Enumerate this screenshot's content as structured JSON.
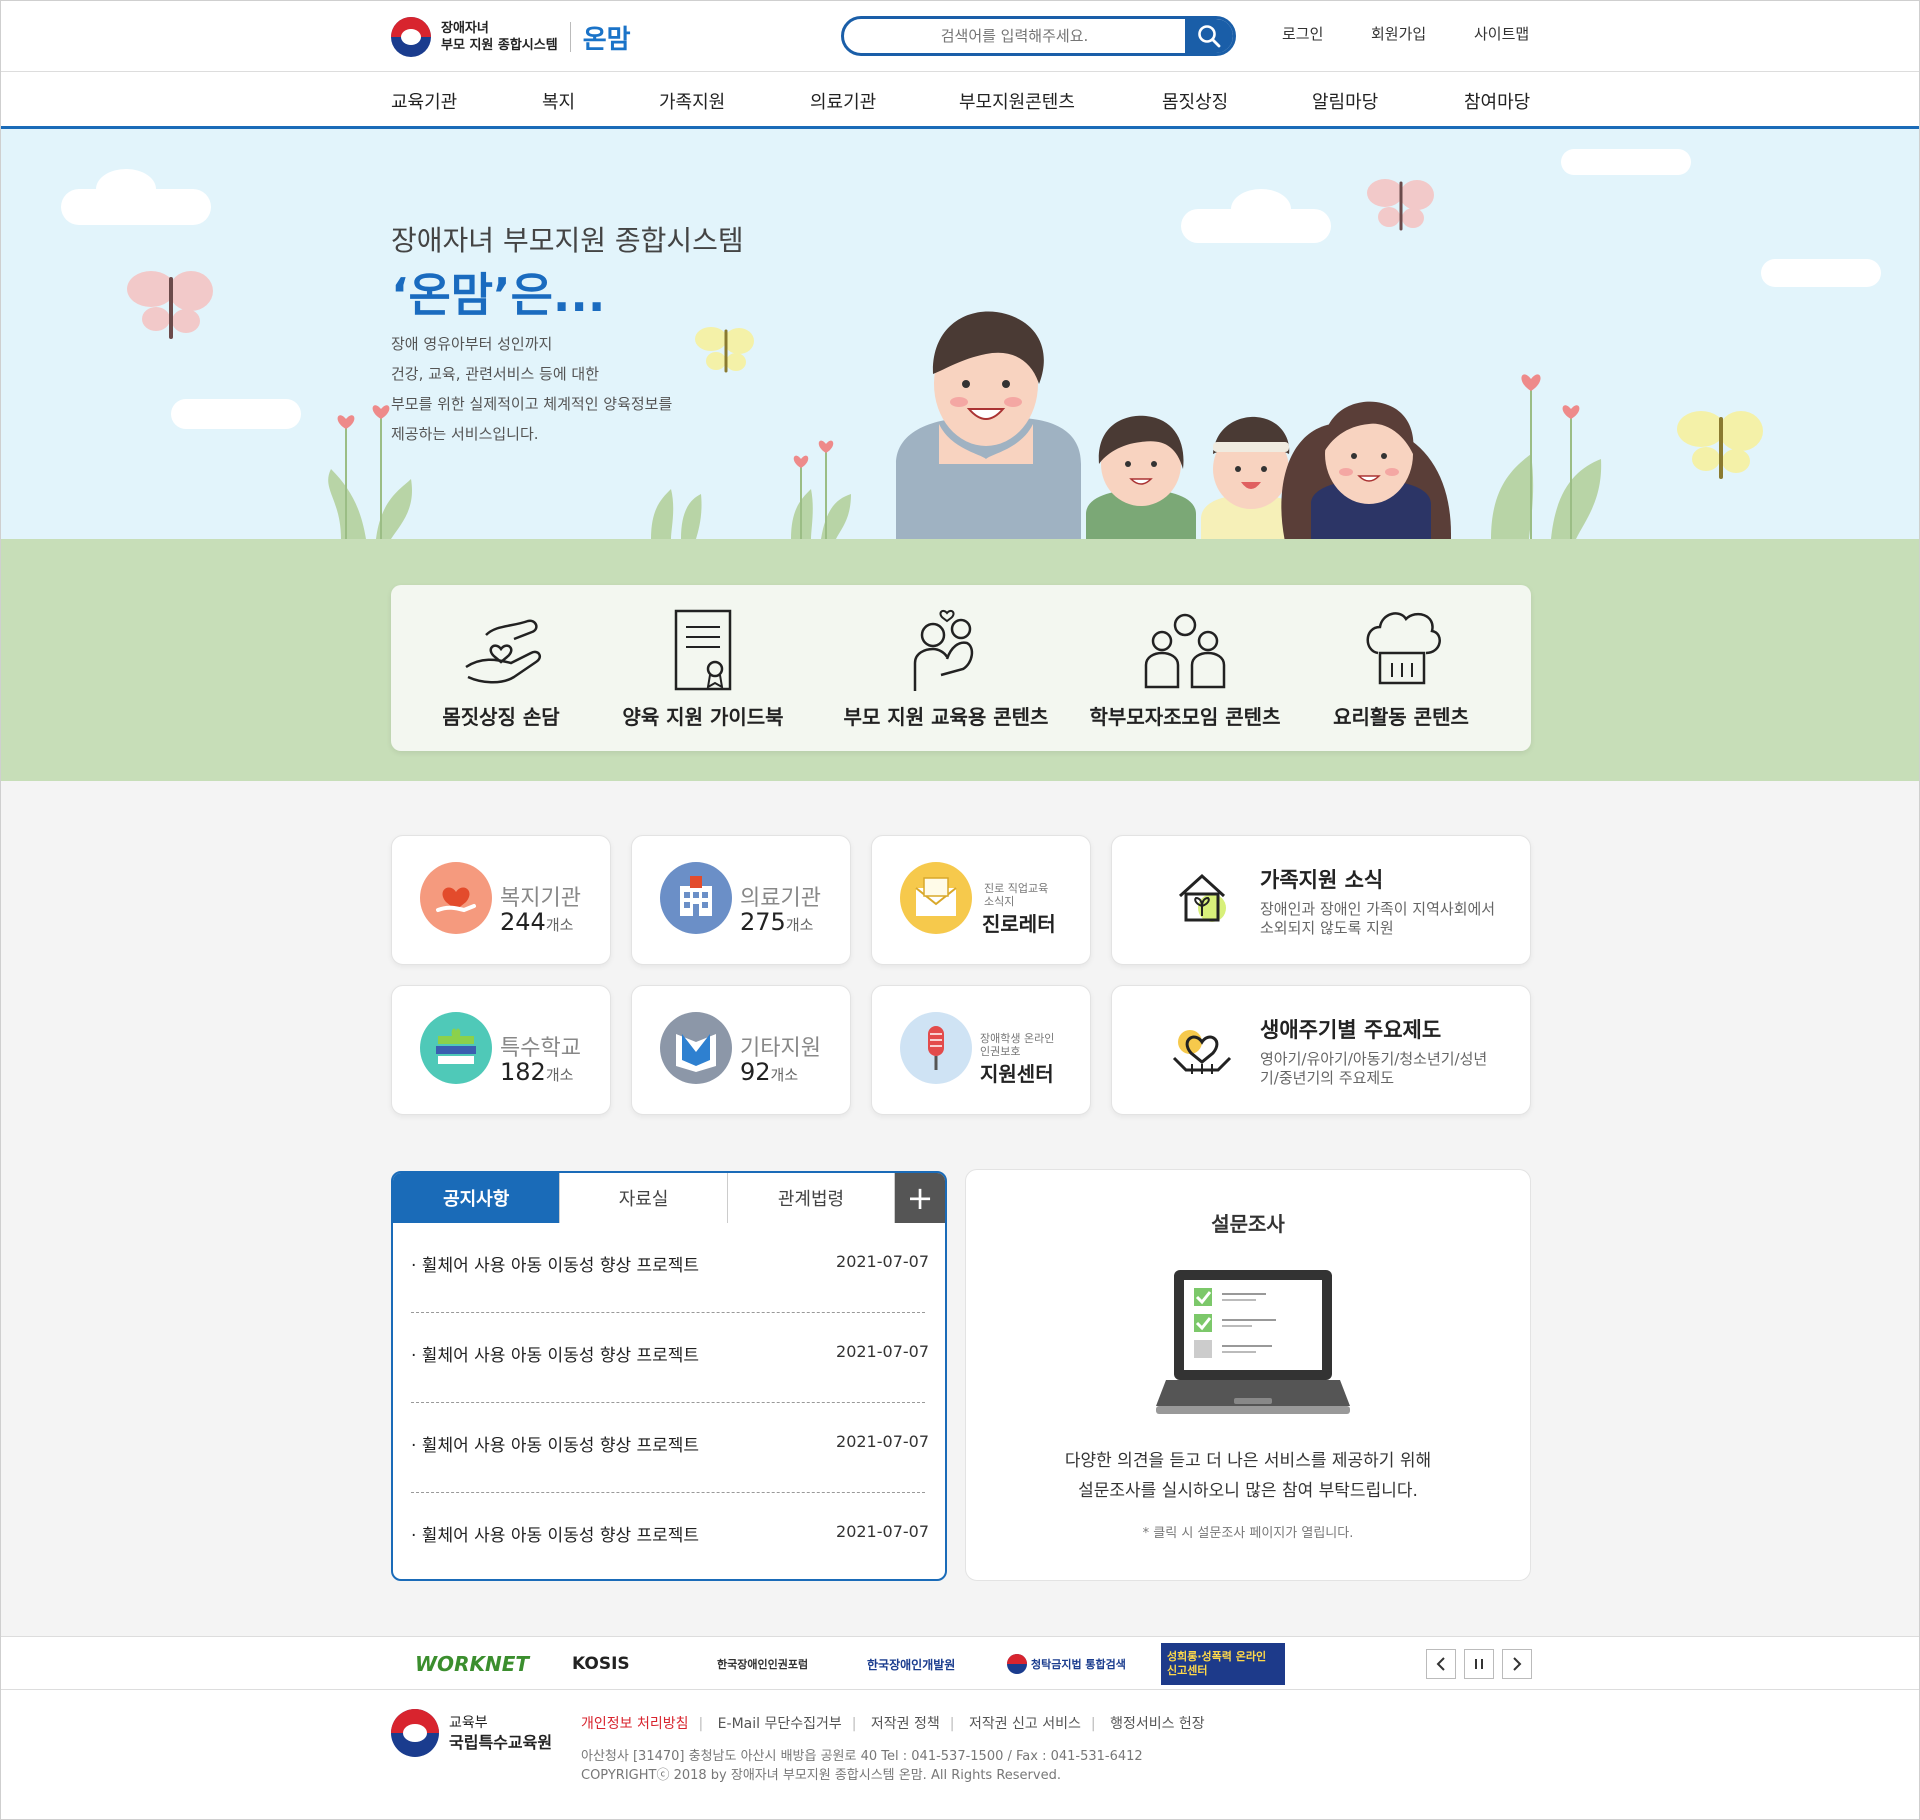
{
  "header": {
    "logo_sub_line1": "장애자녀",
    "logo_sub_line2": "부모 지원 종합시스템",
    "logo_brand": "온맘",
    "search_placeholder": "검색어를 입력해주세요.",
    "login": "로그인",
    "signup": "회원가입",
    "sitemap": "사이트맵"
  },
  "gnb": [
    "교육기관",
    "복지",
    "가족지원",
    "의료기관",
    "부모지원콘텐츠",
    "몸짓상징",
    "알림마당",
    "참여마당"
  ],
  "hero": {
    "title": "장애자녀 부모지원 종합시스템",
    "brand": "‘온맘’은...",
    "desc": [
      "장애 영유아부터 성인까지",
      "건강, 교육, 관련서비스 등에 대한",
      "부모를 위한 실제적이고 체계적인 양육정보를",
      "제공하는 서비스입니다."
    ]
  },
  "quick": [
    {
      "label": "몸짓상징 손담",
      "icon": "hands-heart-icon"
    },
    {
      "label": "양육 지원 가이드북",
      "icon": "guidebook-icon"
    },
    {
      "label": "부모 지원 교육용 콘텐츠",
      "icon": "parent-child-icon"
    },
    {
      "label": "학부모자조모임 콘텐츠",
      "icon": "group-icon"
    },
    {
      "label": "요리활동 콘텐츠",
      "icon": "chef-hat-icon"
    }
  ],
  "stats": [
    {
      "name": "복지기관",
      "count": "244",
      "unit": "개소",
      "color": "#f59a7e",
      "icon": "heart-hand-icon"
    },
    {
      "name": "의료기관",
      "count": "275",
      "unit": "개소",
      "color": "#6b8fc7",
      "icon": "hospital-icon"
    },
    {
      "name": "특수학교",
      "count": "182",
      "unit": "개소",
      "color": "#4fc9b8",
      "icon": "books-icon"
    },
    {
      "name": "기타지원",
      "count": "92",
      "unit": "개소",
      "color": "#8c97a8",
      "icon": "open-book-icon"
    }
  ],
  "small_cards": [
    {
      "sub1": "진로 직업교육",
      "sub2": "소식지",
      "title": "진로레터",
      "color": "#f6c94c",
      "icon": "letter-icon"
    },
    {
      "sub1": "장애학생 온라인",
      "sub2": "인권보호",
      "title": "지원센터",
      "color": "#cfe3f4",
      "icon": "microphone-icon"
    }
  ],
  "wide_cards": [
    {
      "title": "가족지원 소식",
      "desc": "장애인과 장애인 가족이 지역사회에서 소외되지 않도록 지원",
      "icon": "house-sprout-icon"
    },
    {
      "title": "생애주기별 주요제도",
      "desc": "영아기/유아기/아동기/청소년기/성년기/중년기의 주요제도",
      "icon": "hands-heart-house-icon"
    }
  ],
  "notice": {
    "tabs": [
      "공지사항",
      "자료실",
      "관계법령"
    ],
    "plus": "+",
    "rows": [
      {
        "title": "· 휠체어 사용 아동 이동성 향상 프로젝트",
        "date": "2021-07-07"
      },
      {
        "title": "· 휠체어 사용 아동 이동성 향상 프로젝트",
        "date": "2021-07-07"
      },
      {
        "title": "· 휠체어 사용 아동 이동성 향상 프로젝트",
        "date": "2021-07-07"
      },
      {
        "title": "· 휠체어 사용 아동 이동성 향상 프로젝트",
        "date": "2021-07-07"
      }
    ]
  },
  "survey": {
    "title": "설문조사",
    "desc1": "다양한 의견을 듣고 더 나은 서비스를 제공하기 위해",
    "desc2": "설문조사를 실시하오니 많은 참여 부탁드립니다.",
    "note": "* 클릭 시 설문조사 페이지가 열립니다."
  },
  "banners": [
    "WORKNET",
    "KOSIS",
    "한국장애인인권포럼",
    "한국장애인개발원",
    "청탁금지법 통합검색",
    "성희롱·성폭력 온라인 신고센터"
  ],
  "footer": {
    "org1": "교육부",
    "org2": "국립특수교육원",
    "links": [
      "개인정보 처리방침",
      "E-Mail 무단수집거부",
      "저작권 정책",
      "저작권 신고 서비스",
      "행정서비스 헌장"
    ],
    "addr": "아산청사 [31470] 충청남도 아산시 배방읍 공원로 40 Tel : 041-537-1500 / Fax : 041-531-6412",
    "copy": "COPYRIGHTⓒ 2018 by 장애자녀 부모지원 종합시스템 온맘. All Rights Reserved."
  }
}
